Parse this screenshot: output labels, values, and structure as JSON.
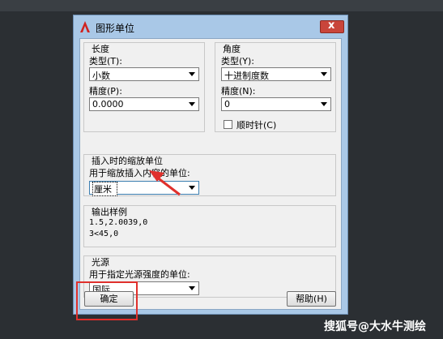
{
  "dialog": {
    "title": "图形单位",
    "close_symbol": "x"
  },
  "length": {
    "heading": "长度",
    "type_label": "类型(T):",
    "type_value": "小数",
    "precision_label": "精度(P):",
    "precision_value": "0.0000"
  },
  "angle": {
    "heading": "角度",
    "type_label": "类型(Y):",
    "type_value": "十进制度数",
    "precision_label": "精度(N):",
    "precision_value": "0",
    "clockwise_label": "顺时针(C)",
    "clockwise_checked": false
  },
  "insert_scale": {
    "heading": "插入时的缩放单位",
    "desc": "用于缩放插入内容的单位:",
    "value": "厘米"
  },
  "sample_output": {
    "heading": "输出样例",
    "line1": "1.5,2.0039,0",
    "line2": "3<45,0"
  },
  "lighting": {
    "heading": "光源",
    "desc": "用于指定光源强度的单位:",
    "value": "国际"
  },
  "buttons": {
    "ok": "确定",
    "help": "帮助(H)"
  },
  "watermark": "搜狐号@大水牛测绘",
  "colors": {
    "annotation_red": "#e0302c",
    "title_bar": "#a9c8e7"
  }
}
